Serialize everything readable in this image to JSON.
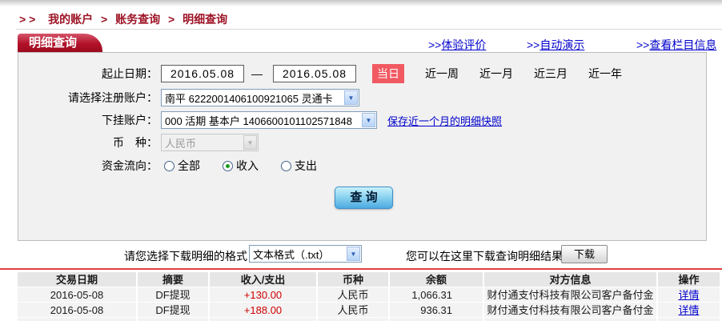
{
  "breadcrumb": {
    "prefix": "> >",
    "separator": ">",
    "items": [
      "我的账户",
      "账务查询",
      "明细查询"
    ]
  },
  "tab": {
    "title": "明细查询"
  },
  "header_links": {
    "prefix": ">>",
    "experience": "体验评价",
    "demo": "自动演示",
    "column_info": "查看栏目信息"
  },
  "form": {
    "date_label": "起止日期：",
    "date_start": "2016.05.08",
    "date_end": "2016.05.08",
    "date_dash": "—",
    "today": "当日",
    "quick": {
      "week": "近一周",
      "month": "近一月",
      "quarter": "近三月",
      "year": "近一年"
    },
    "register_label": "请选择注册账户：",
    "register_value": "南平  6222001406100921065  灵通卡",
    "sub_label": "下挂账户：",
    "sub_value": "000  活期  基本户  1406600101102571848",
    "snapshot_link": "保存近一个月的明细快照",
    "currency_label": "币　种：",
    "currency_value": "人民币",
    "flow_label": "资金流向：",
    "flow_all": "全部",
    "flow_in": "收入",
    "flow_out": "支出",
    "flow_selected": "收入",
    "query_button": "查 询"
  },
  "download": {
    "format_label": "请您选择下载明细的格式",
    "format_value": "文本格式（.txt）",
    "result_hint": "您可以在这里下载查询明细结果",
    "button": "下载"
  },
  "table": {
    "headers": {
      "date": "交易日期",
      "summary": "摘要",
      "amount": "收入/支出",
      "currency": "币种",
      "balance": "余额",
      "counterparty": "对方信息",
      "action": "操作"
    },
    "rows": [
      {
        "date": "2016-05-08",
        "summary": "DF提现",
        "amount": "+130.00",
        "currency": "人民币",
        "balance": "1,066.31",
        "counterparty": "财付通支付科技有限公司客户备付金",
        "action": "详情"
      },
      {
        "date": "2016-05-08",
        "summary": "DF提现",
        "amount": "+188.00",
        "currency": "人民币",
        "balance": "936.31",
        "counterparty": "财付通支付科技有限公司客户备付金",
        "action": "详情"
      }
    ]
  },
  "icons": {
    "dropdown_arrow": "▼"
  },
  "colors": {
    "brand_red": "#9d1325",
    "badge_red": "#f15a62",
    "link_blue": "#0000cc",
    "amount_red": "#cf0000",
    "separator_red": "#e04043",
    "panel_bg": "#f1f1f1"
  }
}
